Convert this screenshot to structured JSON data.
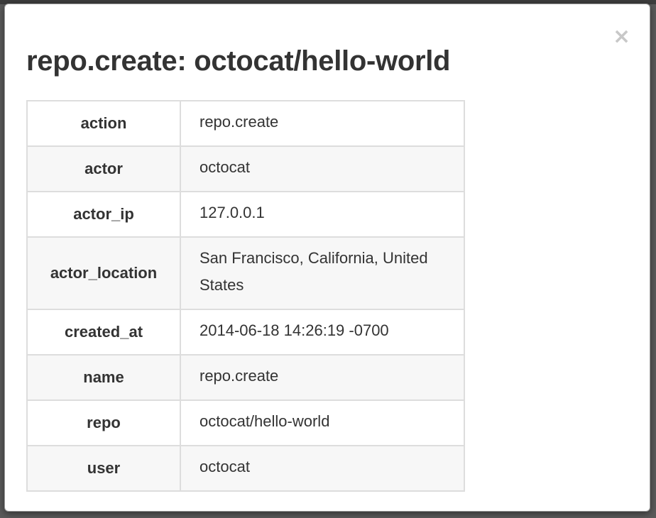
{
  "modal": {
    "title": "repo.create: octocat/hello-world",
    "close_glyph": "×",
    "close_icon": "close-icon"
  },
  "details": [
    {
      "key": "action",
      "value": "repo.create"
    },
    {
      "key": "actor",
      "value": "octocat"
    },
    {
      "key": "actor_ip",
      "value": "127.0.0.1"
    },
    {
      "key": "actor_location",
      "value": "San Francisco, California, United States"
    },
    {
      "key": "created_at",
      "value": "2014-06-18 14:26:19 -0700"
    },
    {
      "key": "name",
      "value": "repo.create"
    },
    {
      "key": "repo",
      "value": "octocat/hello-world"
    },
    {
      "key": "user",
      "value": "octocat"
    }
  ],
  "colors": {
    "title": "#333333",
    "border": "#dddddd",
    "stripe": "#f7f7f7",
    "close": "#c8c8c8"
  }
}
